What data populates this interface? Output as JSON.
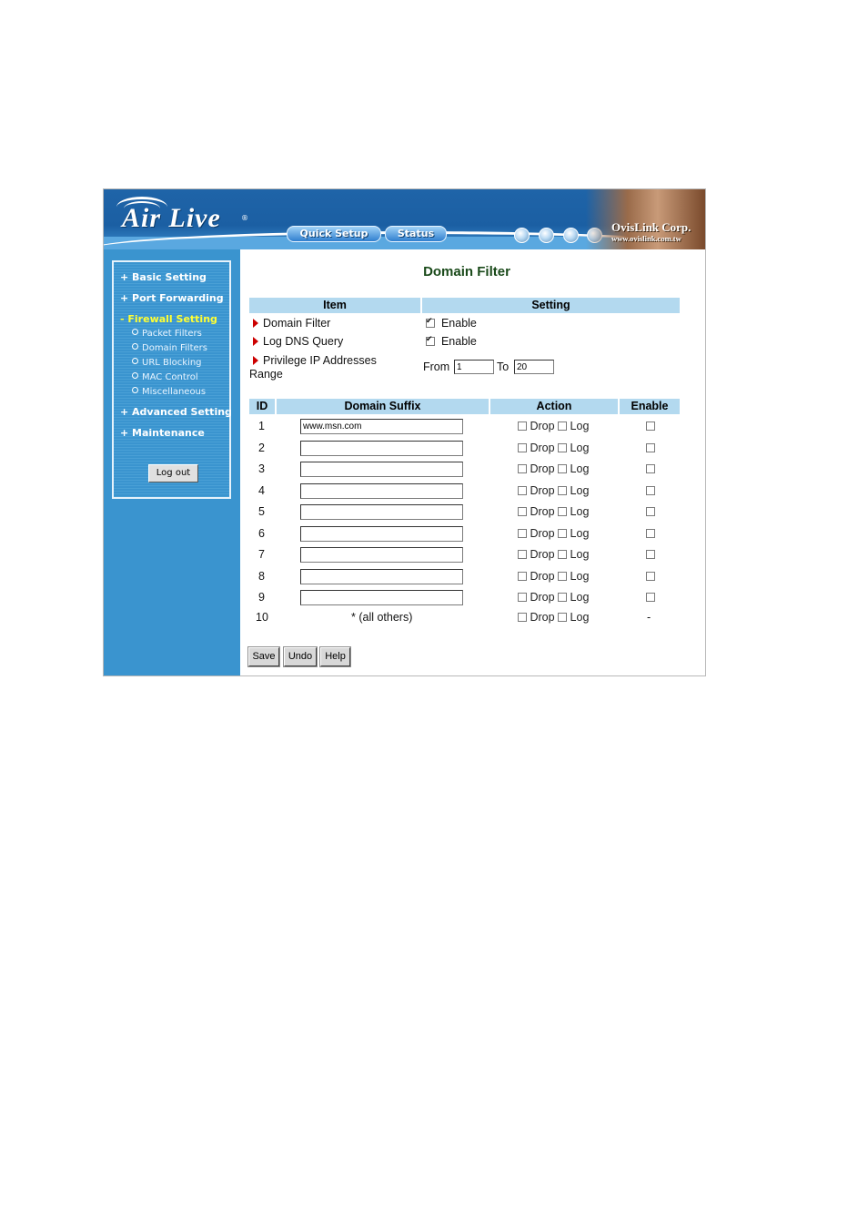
{
  "header": {
    "logo_text": "Air Live",
    "logo_reg": "®",
    "quick_setup_label": "Quick Setup",
    "status_label": "Status",
    "brand": "OvisLink Corp.",
    "brand_url": "www.ovislink.com.tw"
  },
  "sidebar": {
    "items": [
      {
        "label": "+ Basic Setting"
      },
      {
        "label": "+ Port Forwarding"
      },
      {
        "label": "- Firewall Setting"
      }
    ],
    "subitems": [
      {
        "label": "Packet Filters"
      },
      {
        "label": "Domain Filters"
      },
      {
        "label": "URL Blocking"
      },
      {
        "label": "MAC Control"
      },
      {
        "label": "Miscellaneous"
      }
    ],
    "items_after": [
      {
        "label": "+ Advanced Setting"
      },
      {
        "label": "+ Maintenance"
      }
    ],
    "logout_label": "Log out"
  },
  "main": {
    "title": "Domain Filter",
    "settings_table": {
      "header_item": "Item",
      "header_setting": "Setting",
      "rows": [
        {
          "label": "Domain Filter",
          "setting": "Enable",
          "checked": true
        },
        {
          "label": "Log DNS Query",
          "setting": "Enable",
          "checked": true
        }
      ],
      "privilege": {
        "label_line1": "Privilege IP Addresses",
        "label_line2": "Range",
        "from_label": "From",
        "from_value": "1",
        "to_label": "To",
        "to_value": "20"
      }
    },
    "rules_table": {
      "headers": {
        "id": "ID",
        "domain": "Domain Suffix",
        "action": "Action",
        "enable": "Enable"
      },
      "drop_label": "Drop",
      "log_label": "Log",
      "rows": [
        {
          "id": "1",
          "domain": "www.msn.com"
        },
        {
          "id": "2",
          "domain": ""
        },
        {
          "id": "3",
          "domain": ""
        },
        {
          "id": "4",
          "domain": ""
        },
        {
          "id": "5",
          "domain": ""
        },
        {
          "id": "6",
          "domain": ""
        },
        {
          "id": "7",
          "domain": ""
        },
        {
          "id": "8",
          "domain": ""
        },
        {
          "id": "9",
          "domain": ""
        }
      ],
      "last_row": {
        "id": "10",
        "domain_text": "* (all others)",
        "enable_text": "-"
      }
    },
    "buttons": {
      "save": "Save",
      "undo": "Undo",
      "help": "Help"
    }
  }
}
